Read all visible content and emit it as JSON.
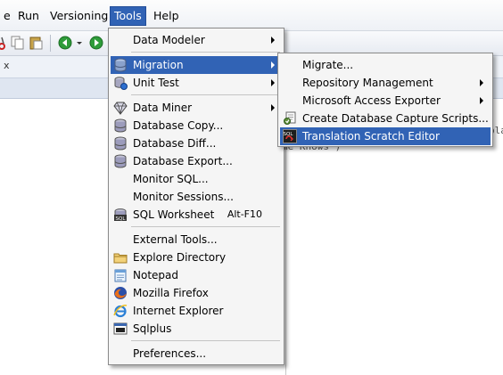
{
  "menubar": {
    "items": [
      "e",
      "Run",
      "Versioning",
      "Tools",
      "Help"
    ]
  },
  "tab": {
    "close_label": "x"
  },
  "editor": {
    "line1": "pla",
    "line2": "me Knows')"
  },
  "tools_menu": {
    "items": [
      {
        "label": "Data Modeler",
        "icon": "none",
        "submenu": true
      },
      {
        "label": "Migration",
        "icon": "database-icon",
        "submenu": true,
        "highlighted": true
      },
      {
        "label": "Unit Test",
        "icon": "unit-test-icon",
        "submenu": true
      },
      {
        "label": "Data Miner",
        "icon": "diamond-icon",
        "submenu": true
      },
      {
        "label": "Database Copy...",
        "icon": "database-icon"
      },
      {
        "label": "Database Diff...",
        "icon": "database-icon"
      },
      {
        "label": "Database Export...",
        "icon": "database-icon"
      },
      {
        "label": "Monitor SQL...",
        "icon": "none"
      },
      {
        "label": "Monitor Sessions...",
        "icon": "none"
      },
      {
        "label": "SQL Worksheet",
        "icon": "sql-worksheet-icon",
        "accelerator": "Alt-F10"
      },
      {
        "label": "External Tools...",
        "icon": "none"
      },
      {
        "label": "Explore Directory",
        "icon": "folder-icon"
      },
      {
        "label": "Notepad",
        "icon": "notepad-icon"
      },
      {
        "label": "Mozilla Firefox",
        "icon": "firefox-icon"
      },
      {
        "label": "Internet Explorer",
        "icon": "internet-explorer-icon"
      },
      {
        "label": "Sqlplus",
        "icon": "terminal-icon"
      },
      {
        "label": "Preferences...",
        "icon": "none"
      }
    ]
  },
  "migration_menu": {
    "items": [
      {
        "label": "Migrate...",
        "submenu": false
      },
      {
        "label": "Repository Management",
        "submenu": true
      },
      {
        "label": "Microsoft Access Exporter",
        "submenu": true
      },
      {
        "label": "Create Database Capture Scripts...",
        "icon": "capture-script-icon"
      },
      {
        "label": "Translation Scratch Editor",
        "icon": "sql-translate-icon",
        "highlighted": true
      }
    ]
  },
  "colors": {
    "highlight": "#3163b5",
    "menu_bg": "#f5f5f5"
  }
}
